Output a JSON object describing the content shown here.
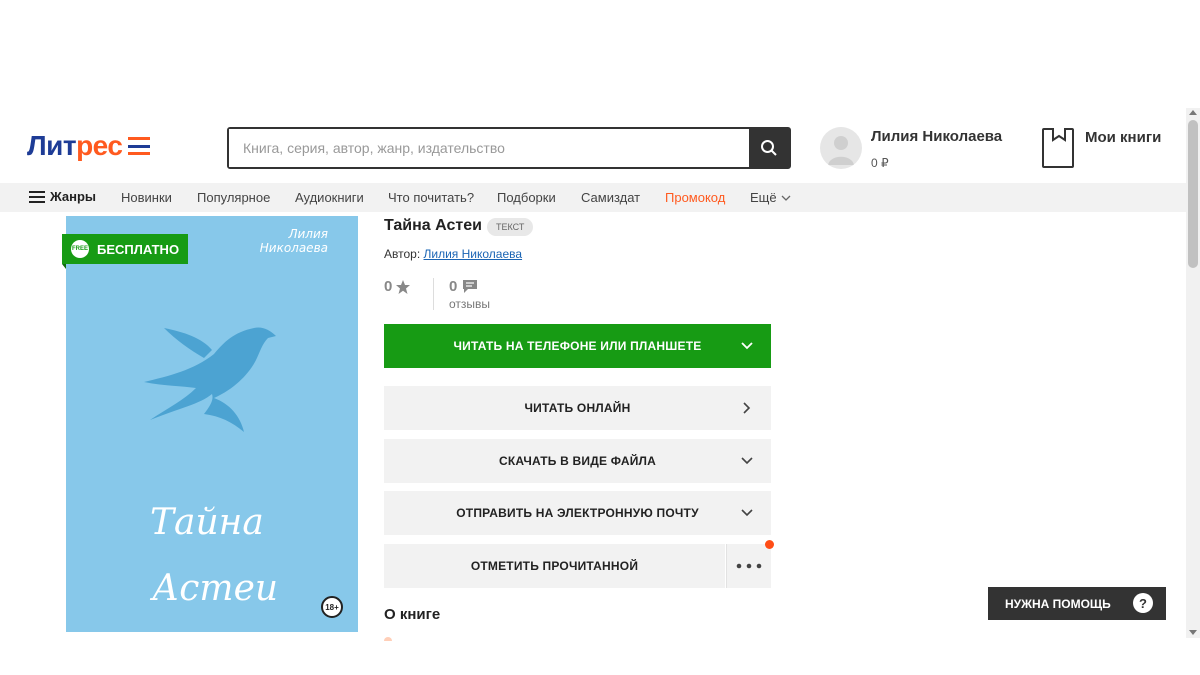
{
  "header": {
    "logo": {
      "part1": "Лит",
      "part2": "рес"
    },
    "search": {
      "placeholder": "Книга, серия, автор, жанр, издательство",
      "value": ""
    },
    "user": {
      "name": "Лилия Николаева",
      "balance": "0 ₽"
    },
    "my_books_label": "Мои книги"
  },
  "nav": {
    "genres": "Жанры",
    "items": [
      "Новинки",
      "Популярное",
      "Аудиокниги",
      "Что почитать?",
      "Подборки",
      "Самиздат",
      "Промокод",
      "Ещё"
    ]
  },
  "cover": {
    "badge": "БЕСПЛАТНО",
    "badge_icon_text": "FREE",
    "author_line1": "Лилия",
    "author_line2": "Николаева",
    "title_line1": "Тайна",
    "title_line2": "Астеи",
    "age_rating": "18+"
  },
  "book": {
    "title": "Тайна Астеи",
    "type": "ТЕКСТ",
    "author_label": "Автор:",
    "author": "Лилия Николаева",
    "rating": "0",
    "reviews_count": "0",
    "reviews_label": "отзывы"
  },
  "actions": {
    "read_device": "ЧИТАТЬ НА ТЕЛЕФОНЕ ИЛИ ПЛАНШЕТЕ",
    "read_online": "ЧИТАТЬ ОНЛАЙН",
    "download": "СКАЧАТЬ В ВИДЕ ФАЙЛА",
    "send_email": "ОТПРАВИТЬ НА ЭЛЕКТРОННУЮ ПОЧТУ",
    "mark_read": "ОТМЕТИТЬ ПРОЧИТАННОЙ"
  },
  "about_heading": "О книге",
  "help": {
    "label": "НУЖНА ПОМОЩЬ",
    "icon_text": "?"
  },
  "colors": {
    "brand_blue": "#1e3c96",
    "brand_orange": "#ff5a1f",
    "green": "#179b14",
    "cover_bg": "#87c8ea"
  }
}
